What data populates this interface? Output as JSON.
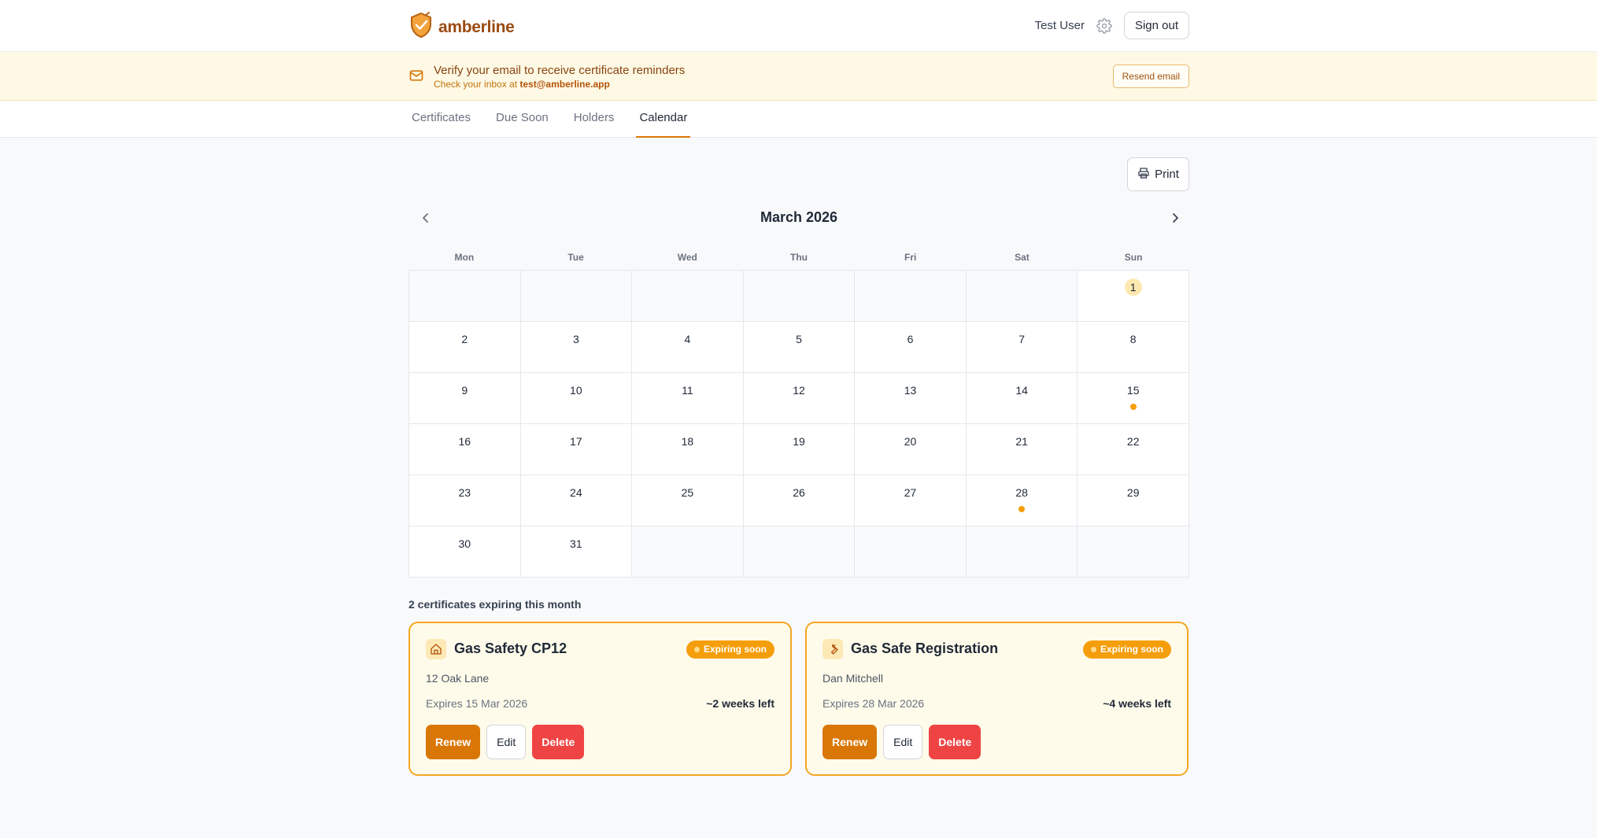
{
  "app": {
    "name": "amberline"
  },
  "header": {
    "user_name": "Test User",
    "signout_label": "Sign out"
  },
  "banner": {
    "title": "Verify your email to receive certificate reminders",
    "sub_prefix": "Check your inbox at ",
    "email": "test@amberline.app",
    "resend_label": "Resend email"
  },
  "tabs": [
    {
      "label": "Certificates"
    },
    {
      "label": "Due Soon"
    },
    {
      "label": "Holders"
    },
    {
      "label": "Calendar",
      "active": true
    }
  ],
  "print_label": "Print",
  "calendar": {
    "month_label": "March 2026",
    "weekdays": [
      "Mon",
      "Tue",
      "Wed",
      "Thu",
      "Fri",
      "Sat",
      "Sun"
    ],
    "weeks": [
      [
        "",
        "",
        "",
        "",
        "",
        "",
        "1"
      ],
      [
        "2",
        "3",
        "4",
        "5",
        "6",
        "7",
        "8"
      ],
      [
        "9",
        "10",
        "11",
        "12",
        "13",
        "14",
        "15"
      ],
      [
        "16",
        "17",
        "18",
        "19",
        "20",
        "21",
        "22"
      ],
      [
        "23",
        "24",
        "25",
        "26",
        "27",
        "28",
        "29"
      ],
      [
        "30",
        "31",
        "",
        "",
        "",
        "",
        ""
      ]
    ],
    "highlighted_day": "1",
    "event_days": [
      "15",
      "28"
    ],
    "event_color": "#f59e0b"
  },
  "expiring": {
    "summary": "2 certificates expiring this month",
    "cards": [
      {
        "icon": "home-icon",
        "title": "Gas Safety CP12",
        "badge": "Expiring soon",
        "subtitle": "12 Oak Lane",
        "expires": "Expires 15 Mar 2026",
        "time_left": "~2 weeks left",
        "renew_label": "Renew",
        "edit_label": "Edit",
        "delete_label": "Delete"
      },
      {
        "icon": "wrench-icon",
        "title": "Gas Safe Registration",
        "badge": "Expiring soon",
        "subtitle": "Dan Mitchell",
        "expires": "Expires 28 Mar 2026",
        "time_left": "~4 weeks left",
        "renew_label": "Renew",
        "edit_label": "Edit",
        "delete_label": "Delete"
      }
    ]
  },
  "colors": {
    "accent": "#d97706",
    "brand": "#9a4a12",
    "danger": "#ef4444",
    "banner_bg": "#fef9e5"
  }
}
